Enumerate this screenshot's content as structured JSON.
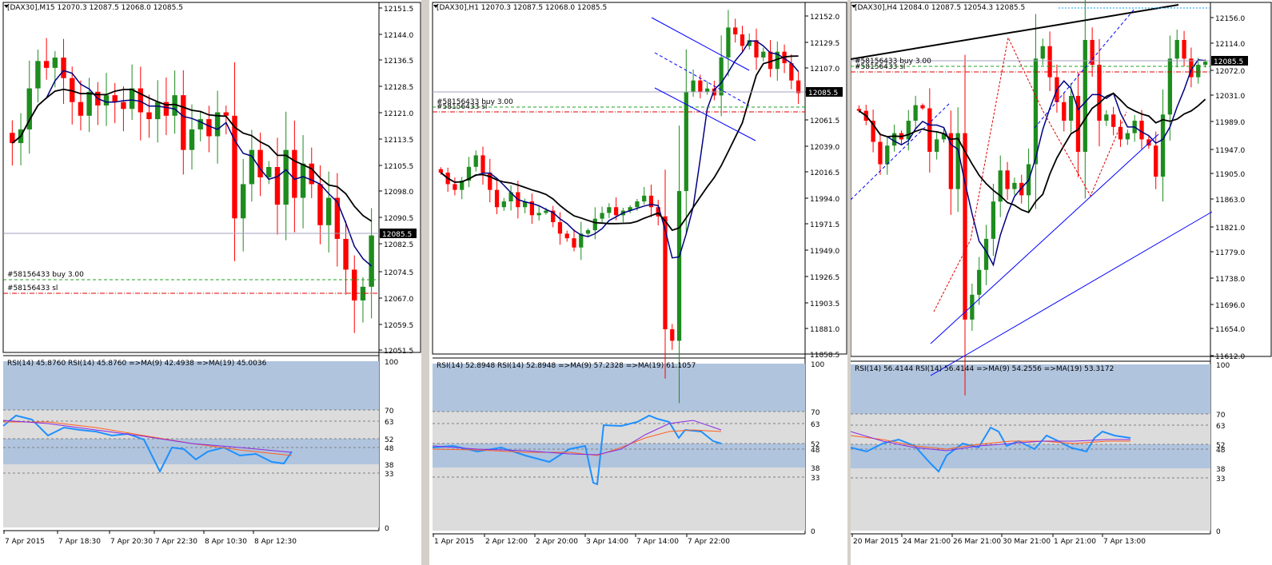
{
  "panels": [
    {
      "id": "m15",
      "header": "[DAX30],M15  12070.3 12087.5 12068.0 12085.5",
      "price_labels": [
        "12151.5",
        "12144.0",
        "12136.5",
        "12128.5",
        "12121.0",
        "12113.5",
        "12105.5",
        "12098.0",
        "12090.5",
        "12082.5",
        "12074.5",
        "12067.0",
        "12059.5",
        "12051.5"
      ],
      "current_price": "12085.5",
      "order_buy": "#58156433 buy 3.00",
      "order_sl": "#58156433 sl",
      "rsi_header": "RSI(14) 45.8760   RSI(14) 45.8760   =>MA(9) 42.4938   =>MA(19) 45.0036",
      "rsi_levels": [
        "100",
        "70",
        "63",
        "52",
        "48",
        "38",
        "33",
        "0"
      ],
      "time_labels": [
        "7 Apr 2015",
        "7 Apr 18:30",
        "7 Apr 20:30",
        "7 Apr 22:30",
        "8 Apr 10:30",
        "8 Apr 12:30"
      ]
    },
    {
      "id": "h1",
      "header": "[DAX30],H1  12070.3 12087.5 12068.0 12085.5",
      "price_labels": [
        "12152.0",
        "12129.5",
        "12107.0",
        "12085.5",
        "12061.5",
        "12039.0",
        "12016.5",
        "11994.0",
        "11971.5",
        "11949.0",
        "11926.5",
        "11903.5",
        "11881.0",
        "11858.5"
      ],
      "current_price": "12085.5",
      "order_buy": "#58156433 buy 3.00",
      "order_sl": "#58156433 sl",
      "rsi_header": "RSI(14) 52.8948   RSI(14) 52.8948   =>MA(9) 57.2328   =>MA(19) 61.1057",
      "rsi_levels": [
        "100",
        "70",
        "63",
        "52",
        "48",
        "38",
        "33",
        "0"
      ],
      "time_labels": [
        "1 Apr 2015",
        "2 Apr 12:00",
        "2 Apr 20:00",
        "3 Apr 14:00",
        "7 Apr 14:00",
        "7 Apr 22:00"
      ]
    },
    {
      "id": "h4",
      "header": "[DAX30],H4  12084.0 12087.5 12054.3 12085.5",
      "price_labels": [
        "12156.0",
        "12114.0",
        "12072.0",
        "12031.0",
        "11989.0",
        "11947.0",
        "11905.0",
        "11863.0",
        "11821.0",
        "11779.0",
        "11738.0",
        "11696.0",
        "11654.0",
        "11612.0"
      ],
      "current_price": "12085.5",
      "order_buy": "#58156433 buy 3.00",
      "order_sl": "#58156433 sl",
      "rsi_header": "RSI(14) 56.4144   RSI(14) 56.4144   =>MA(9) 54.2556   =>MA(19) 53.3172",
      "rsi_levels": [
        "100",
        "70",
        "63",
        "52",
        "48",
        "38",
        "33",
        "0"
      ],
      "time_labels": [
        "20 Mar 2015",
        "24 Mar 21:00",
        "26 Mar 21:00",
        "30 Mar 21:00",
        "1 Apr 21:00",
        "7 Apr 13:00"
      ]
    }
  ],
  "colors": {
    "bull": "#1e8c1e",
    "bear": "#ff0000",
    "ma_fast": "#000080",
    "ma_slow": "#000000",
    "rsi": "#1e90ff",
    "rsi_ma9": "#ff6020",
    "rsi_ma19": "#8a2be2",
    "zone": "#b0c4de",
    "zone_gray": "#dcdcdc"
  }
}
